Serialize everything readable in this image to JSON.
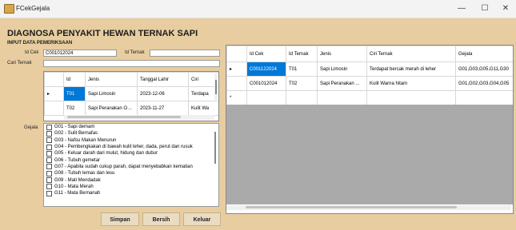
{
  "window": {
    "title": "FCekGejala",
    "minimize": "—",
    "maximize": "☐",
    "close": "✕"
  },
  "form": {
    "heading": "DIAGNOSA PENYAKIT HEWAN TERNAK SAPI",
    "subheading": "INPUT DATA PEMERIKSAAN",
    "id_cek_label": "Id Cek",
    "id_cek_value": "C001012024",
    "id_ternak_label": "Id Ternak",
    "id_ternak_value": "",
    "cari_ternak_label": "Cari Ternak",
    "cari_ternak_value": "",
    "gejala_label": "Gejala"
  },
  "ternak_grid": {
    "columns": [
      "Id",
      "Jenis",
      "Tanggal Lahir",
      "Ciri"
    ],
    "rows": [
      [
        "T01",
        "Sapi Limosin",
        "2023-12-06",
        "Terdapa"
      ],
      [
        "T02",
        "Sapi Peranakan Ongole",
        "2023-11-27",
        "Kulit Wa"
      ]
    ],
    "row_marker": "▸"
  },
  "gejala_list": [
    "G01 - Sapi demam",
    "G02 - Sulit Bernafas",
    "G03 - Nafsu Makan Menurun",
    "G04 - Pembengkakan di bawah kulit leher, dada, perut dan rusuk",
    "G05 - Keluar darah dari mulut, hidung dan dubur",
    "G06 - Tubuh gemetar",
    "G07 - Apabila sudah cukup parah, dapat menyebabkan kematian",
    "G08 - Tubuh lemas dan lesu",
    "G09 - Mati Mendadak",
    "G10 - Mata Merah",
    "G11 - Mata Bernanah"
  ],
  "cek_grid": {
    "columns": [
      "Id Cek",
      "Id Ternak",
      "Jenis",
      "Ciri Ternak",
      "Gejala"
    ],
    "rows": [
      [
        "C001122024",
        "T01",
        "Sapi Limosin",
        "Terdapat bercak merah di leher",
        "G01,G03,G05,G11,G30"
      ],
      [
        "C001012024",
        "T02",
        "Sapi Peranakan ...",
        "Kulit Warna hitam",
        "G01,G02,G03,G04,G05"
      ]
    ],
    "current_marker": "▸",
    "new_marker": "*"
  },
  "buttons": {
    "simpan": "Simpan",
    "bersih": "Bersih",
    "keluar": "Keluar"
  },
  "colors": {
    "form_bg": "#e8cda0",
    "selection": "#0078d7",
    "grid_empty": "#aaaaaa"
  }
}
